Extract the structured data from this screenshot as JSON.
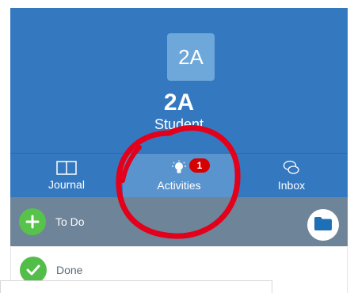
{
  "header": {
    "avatar_text": "2A",
    "class_name": "2A",
    "role": "Student"
  },
  "nav": {
    "items": [
      {
        "label": "Journal",
        "icon": "book-icon"
      },
      {
        "label": "Activities",
        "icon": "lightbulb-icon",
        "badge": "1"
      },
      {
        "label": "Inbox",
        "icon": "chat-icon"
      }
    ]
  },
  "todo": {
    "label": "To Do",
    "icon": "plus-icon",
    "folder_icon": "folder-icon"
  },
  "done": {
    "label": "Done",
    "icon": "check-icon"
  },
  "colors": {
    "header_bg": "#3478c0",
    "active_tab_bg": "#5a94cf",
    "badge": "#d60000",
    "todo_bg": "#6e8498",
    "green": "#58c34b",
    "annotation_red": "#e3001b"
  }
}
